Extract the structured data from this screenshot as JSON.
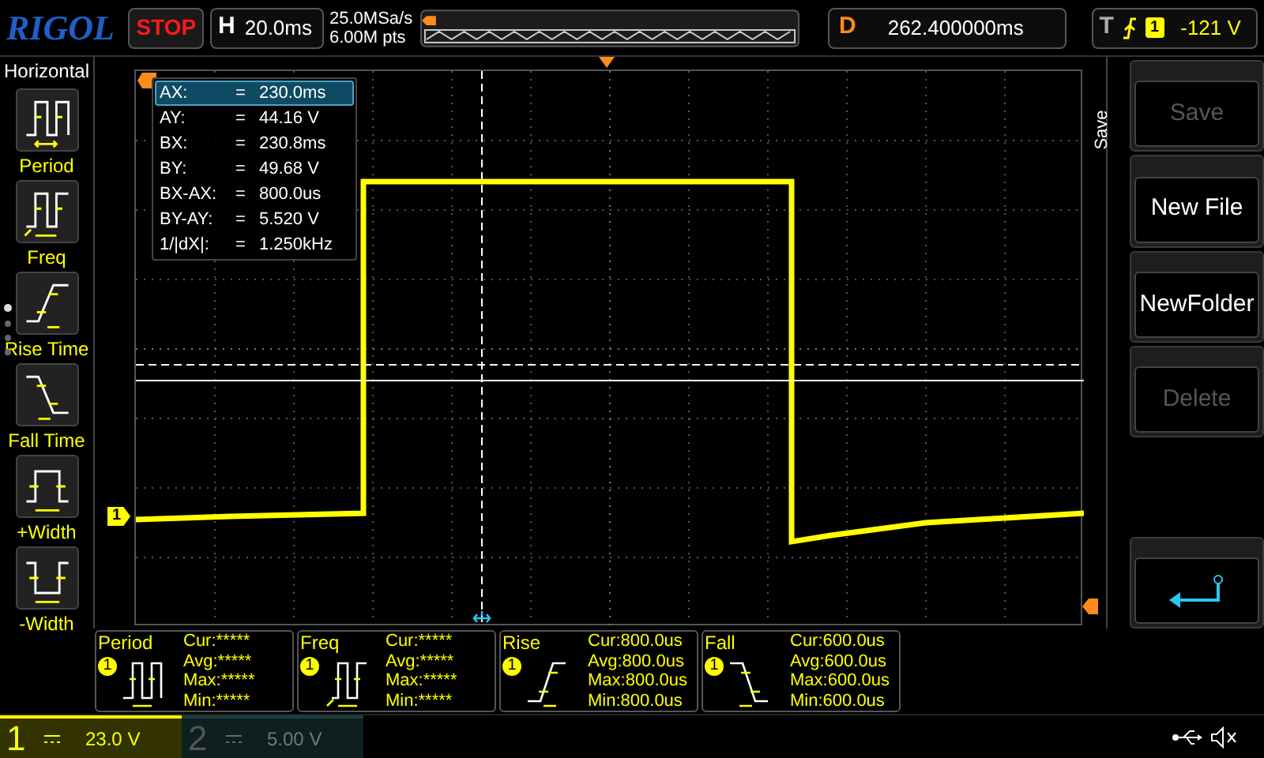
{
  "top_bar": {
    "logo": "RIGOL",
    "run_state": "STOP",
    "horizontal": {
      "label": "H",
      "value": "20.0ms"
    },
    "sample_rate": "25.0MSa/s",
    "memory_depth": "6.00M pts",
    "delay": {
      "label": "D",
      "value": "262.400000ms"
    },
    "trigger": {
      "label": "T",
      "channel": "1",
      "level": "-121 V"
    }
  },
  "sidebar": {
    "title": "Horizontal",
    "items": [
      {
        "label": "Period"
      },
      {
        "label": "Freq"
      },
      {
        "label": "Rise Time"
      },
      {
        "label": "Fall Time"
      },
      {
        "label": "+Width"
      },
      {
        "label": "-Width"
      }
    ]
  },
  "cursor_readout": [
    {
      "label": "AX:",
      "eq": "=",
      "value": "230.0ms",
      "selected": true
    },
    {
      "label": "AY:",
      "eq": "=",
      "value": "44.16 V",
      "selected": false
    },
    {
      "label": "BX:",
      "eq": "=",
      "value": "230.8ms",
      "selected": false
    },
    {
      "label": "BY:",
      "eq": "=",
      "value": "49.68 V",
      "selected": false
    },
    {
      "label": "BX-AX:",
      "eq": "=",
      "value": "800.0us",
      "selected": false
    },
    {
      "label": "BY-AY:",
      "eq": "=",
      "value": "5.520 V",
      "selected": false
    },
    {
      "label": "1/|dX|:",
      "eq": "=",
      "value": "1.250kHz",
      "selected": false
    }
  ],
  "channel_marker": "1",
  "menu": {
    "title": "Save",
    "buttons": [
      {
        "label": "Save",
        "disabled": true
      },
      {
        "label": "New File",
        "disabled": false
      },
      {
        "label": "NewFolder",
        "disabled": false
      },
      {
        "label": "Delete",
        "disabled": true
      }
    ]
  },
  "measurements": [
    {
      "name": "Period",
      "channel": "1",
      "rows": [
        "Cur:*****",
        "Avg:*****",
        "Max:*****",
        "Min:*****"
      ]
    },
    {
      "name": "Freq",
      "channel": "1",
      "rows": [
        "Cur:*****",
        "Avg:*****",
        "Max:*****",
        "Min:*****"
      ]
    },
    {
      "name": "Rise",
      "channel": "1",
      "rows": [
        "Cur:800.0us",
        "Avg:800.0us",
        "Max:800.0us",
        "Min:800.0us"
      ]
    },
    {
      "name": "Fall",
      "channel": "1",
      "rows": [
        "Cur:600.0us",
        "Avg:600.0us",
        "Max:600.0us",
        "Min:600.0us"
      ]
    }
  ],
  "channels": [
    {
      "number": "1",
      "scale": "23.0 V",
      "active": true
    },
    {
      "number": "2",
      "scale": "5.00 V",
      "active": false
    }
  ]
}
